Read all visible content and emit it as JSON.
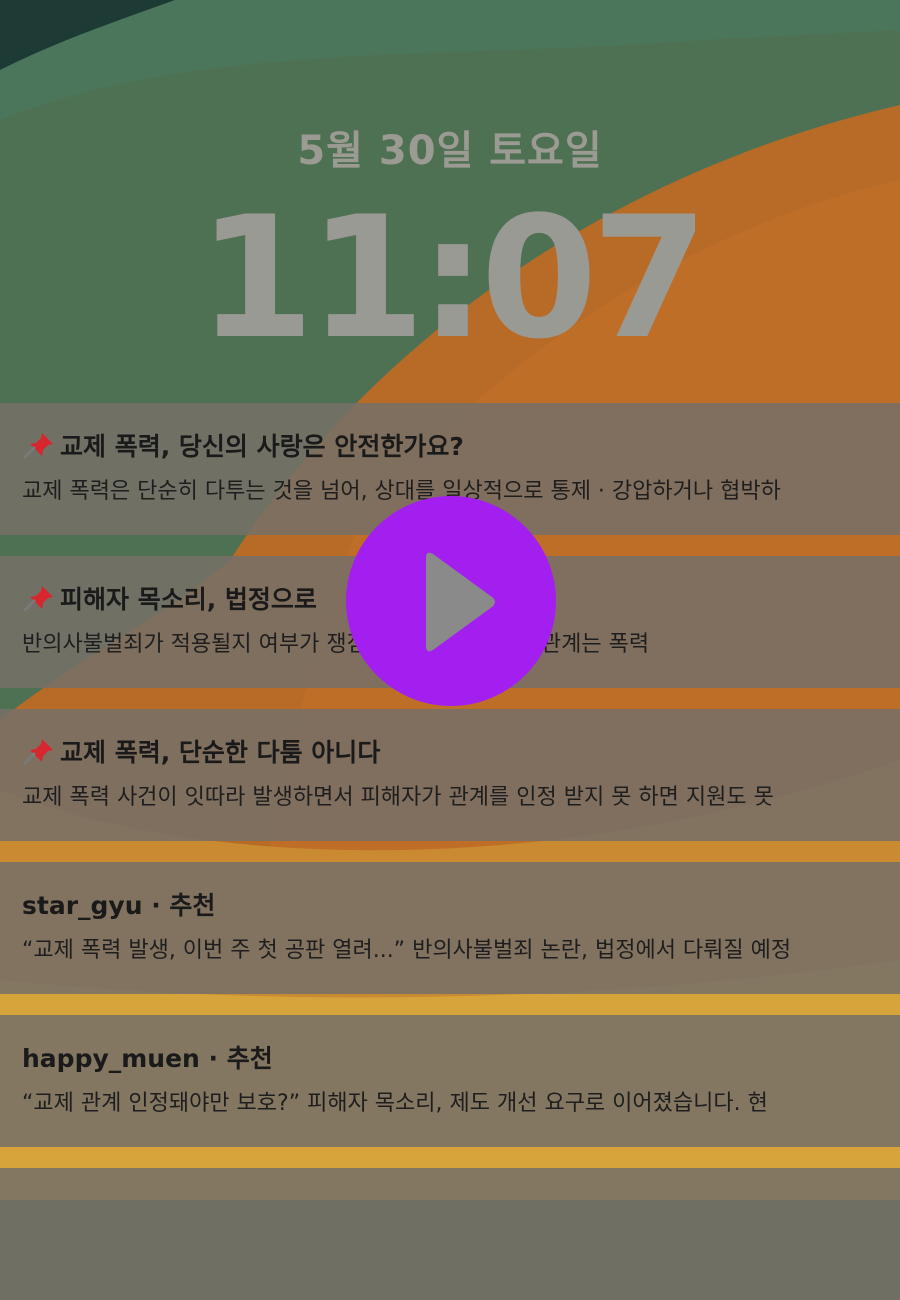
{
  "lockscreen": {
    "date": "5월 30일 토요일",
    "time": "11:07"
  },
  "notifications": [
    {
      "pinned": true,
      "title": "교제 폭력, 당신의 사랑은 안전한가요?",
      "body": "교제 폭력은 단순히 다투는 것을 넘어, 상대를 일상적으로 통제 · 강압하거나 협박하"
    },
    {
      "pinned": true,
      "title": "피해자 목소리, 법정으로",
      "body": "반의사불벌죄가 적용될지 여부가 쟁점이에요. 피해자는 “관계는 폭력"
    },
    {
      "pinned": true,
      "title": "교제 폭력, 단순한 다툼 아니다",
      "body": "교제 폭력 사건이 잇따라 발생하면서 피해자가 관계를 인정 받지 못 하면 지원도 못"
    },
    {
      "pinned": false,
      "title": "star_gyu · 추천",
      "body": "“교제 폭력 발생, 이번 주 첫 공판 열려...” 반의사불벌죄 논란, 법정에서 다뤄질 예정"
    },
    {
      "pinned": false,
      "title": "happy_muen · 추천",
      "body": "“교제 관계 인정돼야만 보호?” 피해자 목소리, 제도 개선 요구로 이어졌습니다. 현"
    }
  ],
  "icons": {
    "pin": "pushpin-icon",
    "play": "play-icon"
  },
  "colors": {
    "play_button": "#a31ff0",
    "pin": "#d8262e"
  }
}
